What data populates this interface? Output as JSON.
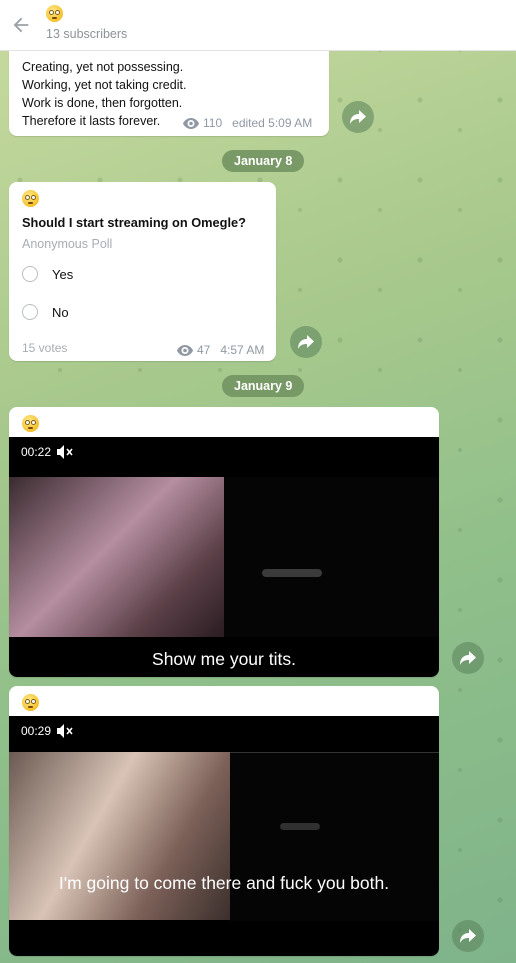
{
  "header": {
    "back_icon": "arrow-left-icon",
    "channel_emoji": "rolling-eyes-emoji",
    "subscribers": "13 subscribers"
  },
  "messages": [
    {
      "lines": "Creating, yet not possessing.\nWorking, yet not taking credit.\nWork is done, then forgotten.\nTherefore it lasts forever.",
      "views": "110",
      "time": "edited 5:09 AM"
    },
    {
      "date": "January 8"
    },
    {
      "author_emoji": "rolling-eyes-emoji",
      "poll_question": "Should I start streaming on Omegle?",
      "poll_type": "Anonymous Poll",
      "options": [
        "Yes",
        "No"
      ],
      "votes": "15 votes",
      "views": "47",
      "time": "4:57 AM"
    },
    {
      "date": "January 9"
    },
    {
      "author_emoji": "rolling-eyes-emoji",
      "duration": "00:22",
      "muted_icon": "speaker-muted-icon",
      "subtitle": "Show me your tits."
    },
    {
      "author_emoji": "rolling-eyes-emoji",
      "duration": "00:29",
      "muted_icon": "speaker-muted-icon",
      "subtitle": "I'm going to come there and fuck you both."
    }
  ],
  "icons": {
    "views": "eye-icon",
    "forward": "share-arrow-icon"
  },
  "colors": {
    "date_pill": "#6e915f",
    "accent": "#4f9ad8"
  }
}
